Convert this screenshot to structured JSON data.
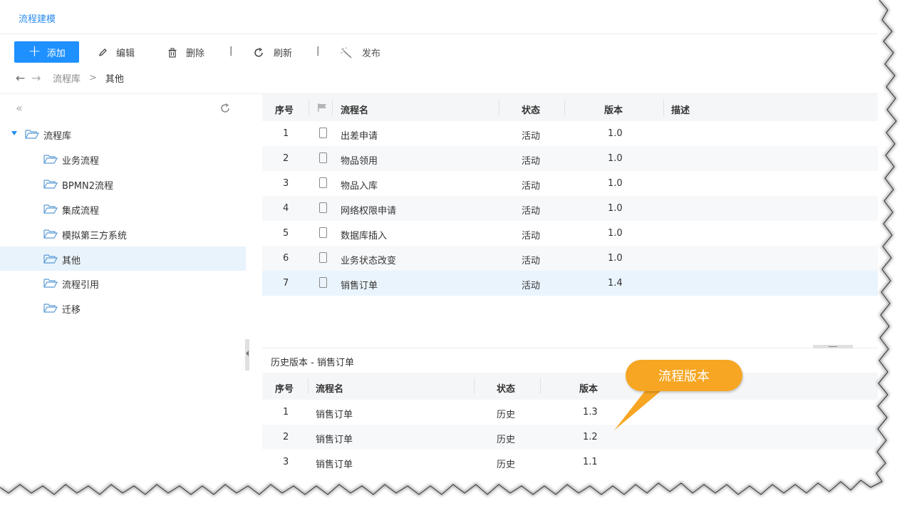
{
  "app": {
    "title": "流程建模"
  },
  "toolbar": {
    "add_label": "添加",
    "edit_label": "编辑",
    "delete_label": "删除",
    "refresh_label": "刷新",
    "publish_label": "发布",
    "separator": "|"
  },
  "breadcrumb": {
    "back": "←",
    "forward": "→",
    "root": "流程库",
    "current": "其他",
    "sep": ">"
  },
  "sidebar": {
    "collapse_icon": "«",
    "root": "流程库",
    "items": [
      {
        "label": "业务流程"
      },
      {
        "label": "BPMN2流程"
      },
      {
        "label": "集成流程"
      },
      {
        "label": "模拟第三方系统"
      },
      {
        "label": "其他"
      },
      {
        "label": "流程引用"
      },
      {
        "label": "迁移"
      }
    ]
  },
  "process_table": {
    "headers": {
      "index": "序号",
      "name": "流程名",
      "status": "状态",
      "version": "版本",
      "description": "描述"
    },
    "rows": [
      {
        "index": "1",
        "name": "出差申请",
        "status": "活动",
        "version": "1.0"
      },
      {
        "index": "2",
        "name": "物品领用",
        "status": "活动",
        "version": "1.0"
      },
      {
        "index": "3",
        "name": "物品入库",
        "status": "活动",
        "version": "1.0"
      },
      {
        "index": "4",
        "name": "网络权限申请",
        "status": "活动",
        "version": "1.0"
      },
      {
        "index": "5",
        "name": "数据库插入",
        "status": "活动",
        "version": "1.0"
      },
      {
        "index": "6",
        "name": "业务状态改变",
        "status": "活动",
        "version": "1.0"
      },
      {
        "index": "7",
        "name": "销售订单",
        "status": "活动",
        "version": "1.4"
      }
    ]
  },
  "history": {
    "title": "历史版本 - 销售订单",
    "headers": {
      "index": "序号",
      "name": "流程名",
      "status": "状态",
      "version": "版本"
    },
    "rows": [
      {
        "index": "1",
        "name": "销售订单",
        "status": "历史",
        "version": "1.3"
      },
      {
        "index": "2",
        "name": "销售订单",
        "status": "历史",
        "version": "1.2"
      },
      {
        "index": "3",
        "name": "销售订单",
        "status": "历史",
        "version": "1.1"
      }
    ]
  },
  "callout": {
    "text": "流程版本"
  },
  "colors": {
    "accent": "#1e90ff",
    "callout": "#f6a623",
    "selected_row": "#eaf4fc"
  }
}
